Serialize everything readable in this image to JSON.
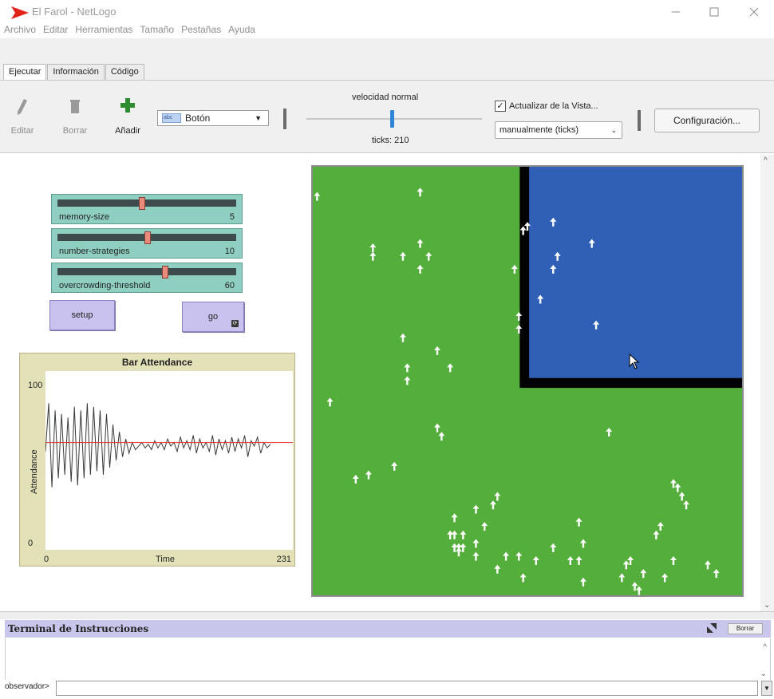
{
  "window": {
    "title": "El Farol - NetLogo"
  },
  "menu": [
    "Archivo",
    "Editar",
    "Herramientas",
    "Tamaño",
    "Pestañas",
    "Ayuda"
  ],
  "tabs": [
    "Ejecutar",
    "Información",
    "Código"
  ],
  "toolbar": {
    "edit_label": "Editar",
    "delete_label": "Borrar",
    "add_label": "Añadir",
    "widget_type": "Botón",
    "speed_label": "velocidad normal",
    "ticks_label": "ticks: 210",
    "update_label": "Actualizar de la Vista...",
    "update_checked": true,
    "update_mode": "manualmente (ticks)",
    "settings_label": "Configuración..."
  },
  "sliders": [
    {
      "name": "memory-size",
      "value": "5",
      "fraction": 0.47
    },
    {
      "name": "number-strategies",
      "value": "10",
      "fraction": 0.5
    },
    {
      "name": "overcrowding-threshold",
      "value": "60",
      "fraction": 0.6
    }
  ],
  "buttons": {
    "setup": "setup",
    "go": "go"
  },
  "plot": {
    "title": "Bar Attendance",
    "xlabel": "Time",
    "ylabel": "Attendance",
    "xmin": "0",
    "xmax": "231",
    "ymin": "0",
    "ymax": "100"
  },
  "chart_data": {
    "type": "line",
    "title": "Bar Attendance",
    "xlabel": "Time",
    "ylabel": "Attendance",
    "xlim": [
      0,
      231
    ],
    "ylim": [
      0,
      100
    ],
    "grid": false,
    "series": [
      {
        "name": "attendance",
        "color": "#3a3a3a",
        "x": [
          0,
          3,
          6,
          9,
          12,
          15,
          18,
          21,
          24,
          27,
          30,
          33,
          36,
          39,
          42,
          45,
          48,
          51,
          54,
          57,
          60,
          63,
          66,
          69,
          72,
          75,
          78,
          81,
          84,
          87,
          90,
          93,
          96,
          99,
          102,
          105,
          108,
          111,
          114,
          117,
          120,
          123,
          126,
          129,
          132,
          135,
          138,
          141,
          144,
          147,
          150,
          153,
          156,
          159,
          162,
          165,
          168,
          171,
          174,
          177,
          180,
          183,
          186,
          189,
          192,
          195,
          198,
          201,
          204,
          207,
          210
        ],
        "y": [
          55,
          82,
          35,
          78,
          40,
          76,
          42,
          74,
          38,
          80,
          36,
          78,
          40,
          82,
          42,
          80,
          44,
          78,
          42,
          76,
          46,
          70,
          50,
          66,
          52,
          62,
          54,
          60,
          56,
          58,
          60,
          57,
          59,
          56,
          61,
          57,
          60,
          56,
          62,
          58,
          60,
          55,
          63,
          57,
          61,
          56,
          64,
          54,
          62,
          57,
          60,
          55,
          64,
          53,
          62,
          56,
          61,
          54,
          63,
          55,
          62,
          57,
          64,
          52,
          61,
          58,
          63,
          54,
          60,
          57,
          59
        ]
      },
      {
        "name": "threshold",
        "color": "#e0302a",
        "x": [
          0,
          231
        ],
        "y": [
          60,
          60
        ]
      }
    ]
  },
  "world": {
    "green": "#54ae3b",
    "blue": "#2f60b6",
    "wall": "#000000",
    "turtle_color": "#ffffff",
    "turtles_green": [
      [
        1,
        7
      ],
      [
        4,
        55
      ],
      [
        10,
        73
      ],
      [
        13,
        72
      ],
      [
        14,
        19
      ],
      [
        14,
        21
      ],
      [
        19,
        70
      ],
      [
        21,
        21
      ],
      [
        21,
        40
      ],
      [
        22,
        47
      ],
      [
        22,
        50
      ],
      [
        25,
        6
      ],
      [
        25,
        18
      ],
      [
        25,
        24
      ],
      [
        27,
        21
      ],
      [
        29,
        43
      ],
      [
        29,
        61
      ],
      [
        30,
        63
      ],
      [
        32,
        47
      ],
      [
        33,
        82
      ],
      [
        42,
        79
      ],
      [
        43,
        77
      ],
      [
        47,
        24
      ],
      [
        48,
        35
      ],
      [
        48,
        38
      ],
      [
        49,
        15
      ],
      [
        50,
        14
      ],
      [
        53,
        31
      ],
      [
        56,
        24
      ],
      [
        56,
        13
      ],
      [
        57,
        21
      ],
      [
        65,
        18
      ],
      [
        66,
        37
      ],
      [
        69,
        62
      ]
    ],
    "turtles_blue": [
      [
        33,
        89
      ],
      [
        34,
        89
      ],
      [
        34,
        90
      ],
      [
        35,
        89
      ],
      [
        32,
        86
      ],
      [
        33,
        86
      ],
      [
        35,
        86
      ],
      [
        38,
        91
      ],
      [
        38,
        88
      ],
      [
        38,
        80
      ],
      [
        40,
        84
      ],
      [
        43,
        94
      ],
      [
        45,
        91
      ],
      [
        48,
        91
      ],
      [
        49,
        96
      ],
      [
        52,
        92
      ],
      [
        56,
        89
      ],
      [
        60,
        92
      ],
      [
        62,
        92
      ],
      [
        62,
        83
      ],
      [
        63,
        97
      ],
      [
        63,
        88
      ],
      [
        72,
        96
      ],
      [
        73,
        93
      ],
      [
        74,
        92
      ],
      [
        75,
        98
      ],
      [
        76,
        99
      ],
      [
        77,
        95
      ],
      [
        80,
        86
      ],
      [
        81,
        84
      ],
      [
        82,
        96
      ],
      [
        84,
        92
      ],
      [
        84,
        74
      ],
      [
        85,
        75
      ],
      [
        86,
        77
      ],
      [
        87,
        79
      ],
      [
        92,
        93
      ],
      [
        94,
        95
      ]
    ]
  },
  "terminal": {
    "title": "Terminal de Instrucciones",
    "clear_label": "Borrar",
    "prompt": "observador>"
  }
}
